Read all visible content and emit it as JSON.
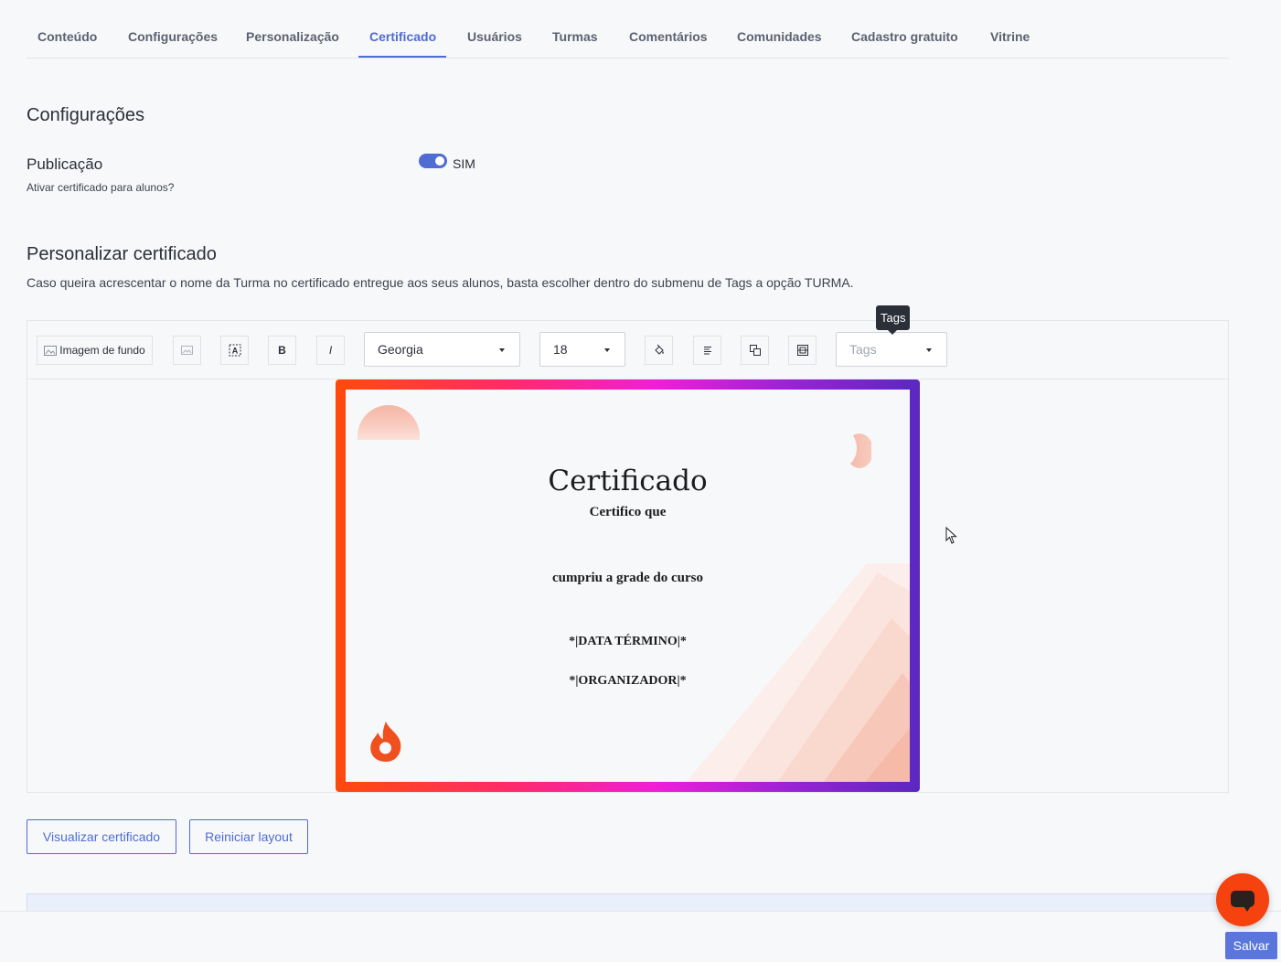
{
  "tabs": [
    {
      "label": "Conteúdo"
    },
    {
      "label": "Configurações"
    },
    {
      "label": "Personalização"
    },
    {
      "label": "Certificado",
      "active": true
    },
    {
      "label": "Usuários"
    },
    {
      "label": "Turmas"
    },
    {
      "label": "Comentários"
    },
    {
      "label": "Comunidades"
    },
    {
      "label": "Cadastro gratuito"
    },
    {
      "label": "Vitrine"
    }
  ],
  "settings": {
    "title": "Configurações",
    "publication_label": "Publicação",
    "publication_hint": "Ativar certificado para alunos?",
    "toggle_on": true,
    "toggle_text": "SIM"
  },
  "customize": {
    "title": "Personalizar certificado",
    "description": "Caso queira acrescentar o nome da Turma no certificado entregue aos seus alunos, basta escolher dentro do submenu de Tags a opção TURMA."
  },
  "toolbar": {
    "background_image_label": "Imagem de fundo",
    "bold_label": "B",
    "italic_label": "I",
    "font_value": "Georgia",
    "size_value": "18",
    "tags_placeholder": "Tags",
    "tooltip": "Tags"
  },
  "certificate": {
    "title": "Certificado",
    "line1": "Certifico que",
    "line2": "cumpriu a grade do curso",
    "line3": "*|DATA TÉRMINO|*",
    "line4": "*|ORGANIZADOR|*",
    "gradient_colors": [
      "#ff4a0a",
      "#ff2a6a",
      "#f01ed8",
      "#9a22d6",
      "#5a28c0"
    ]
  },
  "actions": {
    "preview_label": "Visualizar certificado",
    "reset_label": "Reiniciar layout",
    "save_label": "Salvar"
  },
  "colors": {
    "accent": "#4f6cd4",
    "chat": "#f5420f"
  }
}
